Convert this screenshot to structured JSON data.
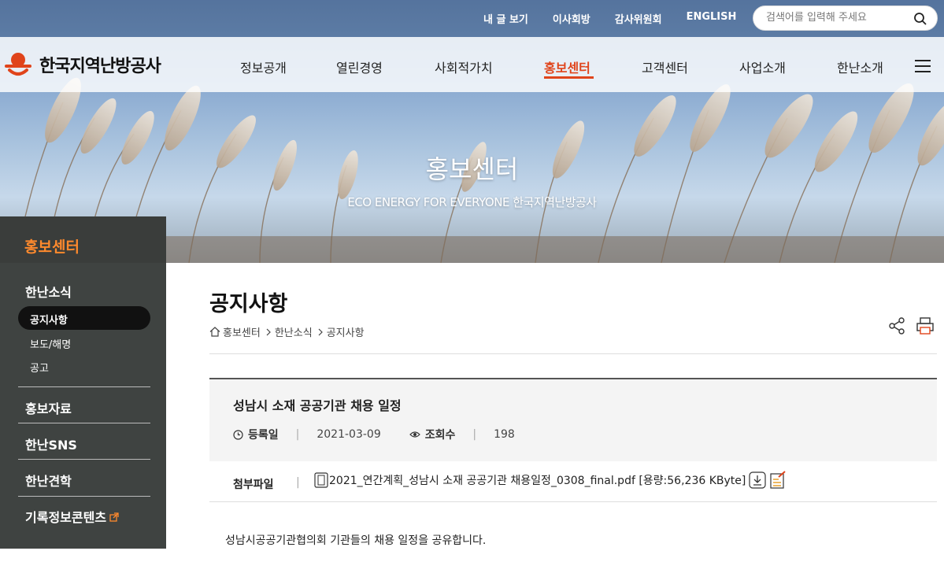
{
  "utility": {
    "links": [
      "내 글 보기",
      "이사회방",
      "감사위원회",
      "ENGLISH"
    ],
    "search_placeholder": "검색어를 입력해 주세요"
  },
  "logo": {
    "text": "한국지역난방공사"
  },
  "gnb": {
    "items": [
      "정보공개",
      "열린경영",
      "사회적가치",
      "홍보센터",
      "고객센터",
      "사업소개",
      "한난소개"
    ],
    "active": "홍보센터"
  },
  "hero": {
    "title": "홍보센터",
    "subtitle": "ECO ENERGY FOR EVERYONE 한국지역난방공사"
  },
  "lnb": {
    "header": "홍보센터",
    "sections": [
      {
        "label": "한난소식",
        "items": [
          "공지사항",
          "보도/해명",
          "공고"
        ]
      },
      {
        "label": "홍보자료"
      },
      {
        "label": "한난SNS"
      },
      {
        "label": "한난견학"
      },
      {
        "label": "기록정보콘텐츠"
      }
    ],
    "active_item": "공지사항"
  },
  "page": {
    "title": "공지사항",
    "breadcrumb": [
      "홍보센터",
      "한난소식",
      "공지사항"
    ]
  },
  "post": {
    "title": "성남시 소재 공공기관 채용 일정",
    "date_label": "등록일",
    "date": "2021-03-09",
    "views_label": "조회수",
    "views": "198",
    "attach_label": "첨부파일",
    "attach_file": "2021_연간계획_성남시 소재 공공기관 채용일정_0308_final.pdf [용량:56,236 KByte]",
    "body": "성남시공공기관협의회 기관들의 채용 일정을 공유합니다."
  },
  "colors": {
    "accent": "#e0441b",
    "lnb_header": "#ff8a2d",
    "lnb_bg": "#3f4341"
  }
}
